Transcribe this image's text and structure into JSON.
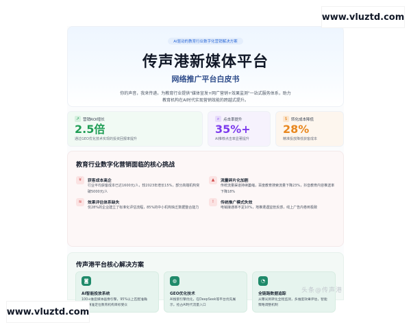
{
  "hero": {
    "tag": "AI驱动的教育行业数字化营销解决方案",
    "title": "传声港新媒体平台",
    "subtitle": "网络推广平台白皮书",
    "description": "你的声音，我来传递。为教育行业提供\"媒体宣发+网广营销+效果监测\"一站式服务体系，助力教育机构在AI时代实现营销效能的跨越式提升。"
  },
  "stats": [
    {
      "label": "营销ROI增长",
      "value": "2.5倍",
      "note": "通过GEO优化技术实现的投资回报率提升",
      "color": "#1f9d55",
      "icon": "trend-up-icon"
    },
    {
      "label": "点击率提升",
      "value": "35%+",
      "note": "AI推荐点击率显著提升",
      "color": "#7c3aed",
      "icon": "search-icon"
    },
    {
      "label": "转化成本降低",
      "value": "28%",
      "note": "精准投放降低获客成本",
      "color": "#e8871e",
      "icon": "coin-icon"
    }
  ],
  "challenges": {
    "title": "教育行业数字化营销面临的核心挑战",
    "items": [
      {
        "name": "获客成本高企",
        "desc": "行业平均获客成本已达1600元/人，较2023年增长15%，部分高端机构突破5000元/人"
      },
      {
        "name": "流量碎片化加剧",
        "desc": "传统流量渠道持续萎缩，百度教育搜索流量下降23%，抖音教育内容推送率下降18%"
      },
      {
        "name": "效果评估体系缺失",
        "desc": "仅28%的企业建立了标准化评估流程，85%的中小机构缺乏数据整合能力"
      },
      {
        "name": "传统推广模式失效",
        "desc": "电销接通率不足10%，地推遭遇监管反感，线上广告内卷到极致"
      }
    ]
  },
  "solutions": {
    "title": "传声港平台核心解决方案",
    "items": [
      {
        "name": "AI智能投放系统",
        "desc": "100+维度媒体画像引擎，95%以上匹配准确率，精准定位教育机构目标受众"
      },
      {
        "name": "GEO优化技术",
        "desc": "AI搜索引擎优化，在DeepSeek等平台优先展示，抢占AI时代流量入口"
      },
      {
        "name": "全链路数据追踪",
        "desc": "从曝光到转化全程监测，多维度效果评估，智能策略调整机制"
      }
    ]
  },
  "watermark": "头条@传声港",
  "url_banners": {
    "top": "www.vluztd.com",
    "bottom": "www.vluztd.com"
  }
}
